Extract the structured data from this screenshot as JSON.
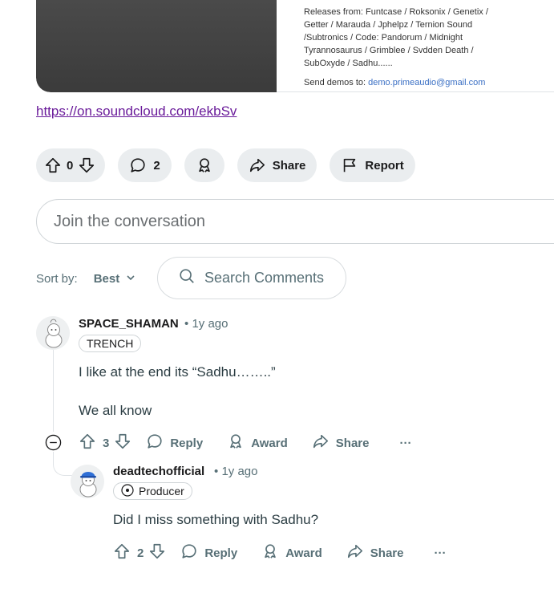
{
  "media": {
    "releases_text": "Releases from: Funtcase / Roksonix / Genetix / Getter / Marauda / Jphelpz / Ternion Sound /Subtronics / Code: Pandorum / Midnight Tyrannosaurus / Grimblee / Svdden Death / SubOxyde / Sadhu......",
    "demo_label": "Send demos to:",
    "demo_email": "demo.primeaudio@gmail.com"
  },
  "post": {
    "link": "https://on.soundcloud.com/ekbSv",
    "vote_count": "0",
    "comment_count": "2",
    "share_label": "Share",
    "report_label": "Report"
  },
  "composer": {
    "placeholder": "Join the conversation"
  },
  "sort": {
    "label": "Sort by:",
    "value": "Best"
  },
  "search": {
    "placeholder": "Search Comments"
  },
  "comments": [
    {
      "author": "SPACE_SHAMAN",
      "time": "1y ago",
      "flair": "TRENCH",
      "lines": [
        "I like at the end its “Sadhu……..”",
        "We all know"
      ],
      "votes": "3",
      "reply_label": "Reply",
      "award_label": "Award",
      "share_label": "Share",
      "more_label": "···"
    },
    {
      "author": "deadtechofficial",
      "time": "1y ago",
      "flair": "Producer",
      "lines": [
        "Did I miss something with Sadhu?"
      ],
      "votes": "2",
      "reply_label": "Reply",
      "award_label": "Award",
      "share_label": "Share",
      "more_label": "···"
    }
  ],
  "separator": "•"
}
